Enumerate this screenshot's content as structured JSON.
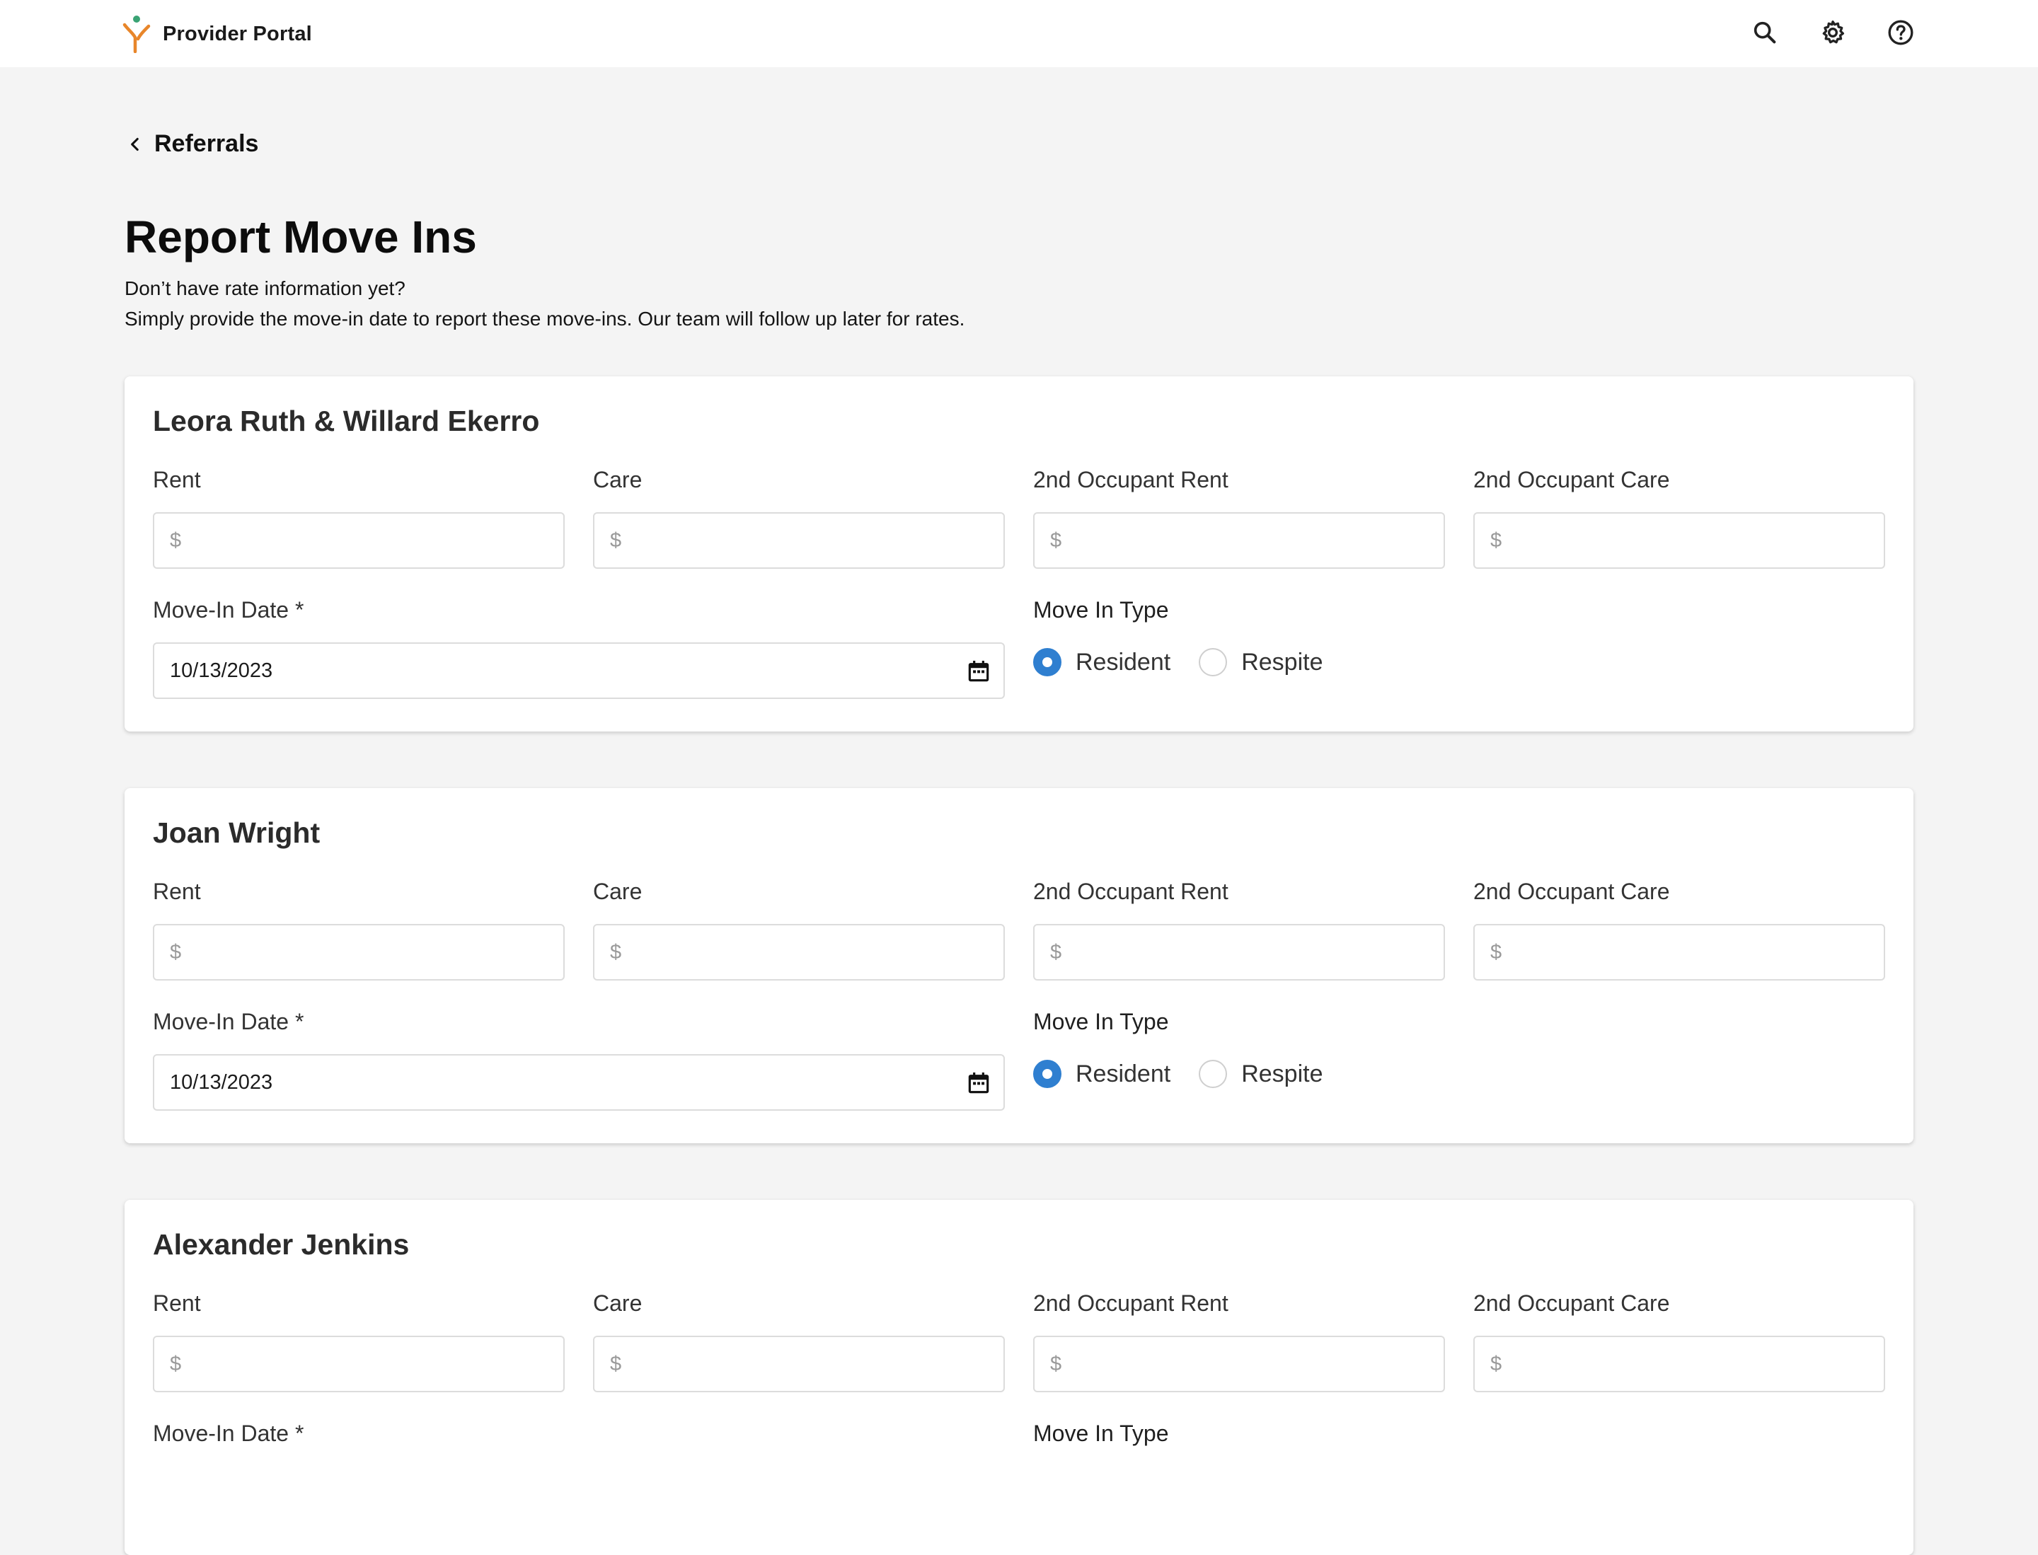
{
  "header": {
    "brand": "Provider Portal",
    "icons": [
      "search-icon",
      "gear-icon",
      "help-icon"
    ],
    "logo_colors": {
      "figure": "#e8862a",
      "head": "#3aa374"
    }
  },
  "back_link": {
    "label": "Referrals"
  },
  "page": {
    "title": "Report Move Ins",
    "subtitle_line1": "Don’t have rate information yet?",
    "subtitle_line2": "Simply provide the move-in date to report these move-ins. Our team will follow up later for rates."
  },
  "labels": {
    "rent": "Rent",
    "care": "Care",
    "second_rent": "2nd Occupant Rent",
    "second_care": "2nd Occupant Care",
    "move_in_date": "Move-In Date *",
    "move_in_type": "Move In Type",
    "resident": "Resident",
    "respite": "Respite",
    "currency_placeholder": "$"
  },
  "accent_color": "#2f7fd0",
  "referrals": [
    {
      "name": "Leora Ruth & Willard Ekerro",
      "move_in_date": "10/13/2023",
      "move_in_type": "Resident"
    },
    {
      "name": "Joan Wright",
      "move_in_date": "10/13/2023",
      "move_in_type": "Resident"
    },
    {
      "name": "Alexander Jenkins",
      "move_in_date": "",
      "move_in_type": ""
    }
  ]
}
